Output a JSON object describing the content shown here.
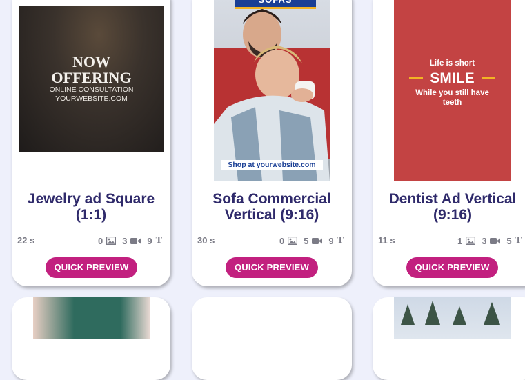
{
  "cards": [
    {
      "title_lines": [
        "Jewelry ad Square",
        "(1:1)"
      ],
      "duration": "22 s",
      "images": "0",
      "videos": "3",
      "texts": "9",
      "button": "QUICK PREVIEW",
      "thumb_text": {
        "line1": "NOW",
        "line2": "OFFERING",
        "line3": "ONLINE CONSULTATION",
        "line4": "YOURWEBSITE.COM"
      }
    },
    {
      "title_lines": [
        "Sofa Commercial",
        "Vertical (9:16)"
      ],
      "duration": "30 s",
      "images": "0",
      "videos": "5",
      "texts": "9",
      "button": "QUICK PREVIEW",
      "thumb_text": {
        "banner": "SOFAS",
        "cta": "Shop at yourwebsite.com"
      }
    },
    {
      "title_lines": [
        "Dentist Ad Vertical",
        "(9:16)"
      ],
      "duration": "11 s",
      "images": "1",
      "videos": "3",
      "texts": "5",
      "button": "QUICK PREVIEW",
      "thumb_text": {
        "line1": "Life is short",
        "line2": "SMILE",
        "line3": "While you still have",
        "line4": "teeth"
      }
    }
  ],
  "colors": {
    "accent": "#c2207f",
    "title": "#2f2a6b",
    "background": "#eef0fb",
    "dentist_red": "#c34343"
  },
  "icons": [
    "image-icon",
    "video-icon",
    "text-icon"
  ]
}
